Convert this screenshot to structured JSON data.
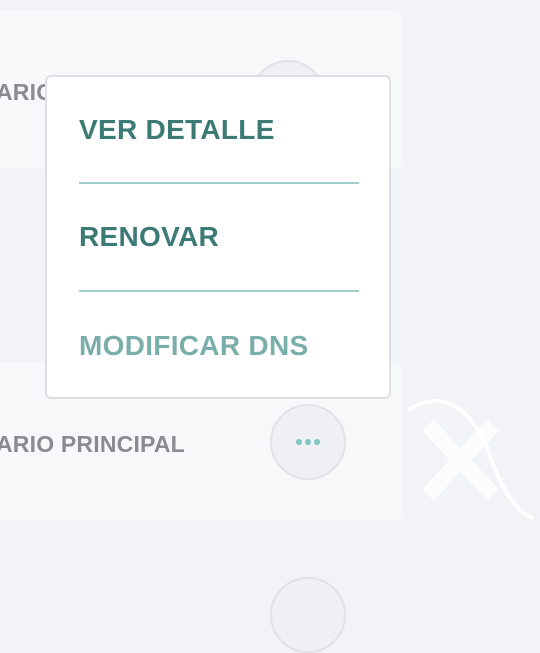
{
  "cards": [
    {
      "label": "ARIO PRINCIPAL"
    },
    {
      "label": "ARIO PRINCIPAL"
    }
  ],
  "menu": {
    "items": [
      {
        "label": "VER DETALLE"
      },
      {
        "label": "RENOVAR"
      },
      {
        "label": "MODIFICAR DNS"
      }
    ]
  },
  "icons": {
    "more": "more-horizontal-icon",
    "watermark": "x-logo-watermark-icon"
  },
  "colors": {
    "accent": "#3c7a76",
    "accent_muted": "#7aaeaa",
    "divider": "#9fd0cc",
    "dots": "#7fc6c0"
  }
}
